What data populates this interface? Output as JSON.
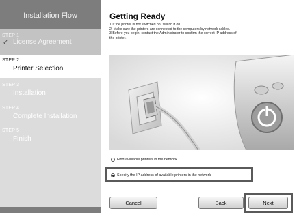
{
  "sidebar": {
    "title": "Installation Flow",
    "steps": [
      {
        "num": "STEP 1",
        "label": "License Agreement",
        "status": "done"
      },
      {
        "num": "STEP 2",
        "label": "Printer Selection",
        "status": "current"
      },
      {
        "num": "STEP 3",
        "label": "Installation",
        "status": "pending"
      },
      {
        "num": "STEP 4",
        "label": "Complete Installation",
        "status": "pending"
      },
      {
        "num": "STEP 5",
        "label": "Finish",
        "status": "pending"
      }
    ]
  },
  "main": {
    "title": "Getting Ready",
    "instructions": [
      "1.If the printer is not switched on, switch it on.",
      "2. Make sure the printers are connected to the computers by network cables.",
      "3.Before you begin, contact the Administrator to confirm the correct IP address of",
      "the printer."
    ],
    "options": [
      {
        "label": "Find available printers in the network",
        "selected": false
      },
      {
        "label": "Specify the IP address of available printers in the network",
        "selected": true
      }
    ]
  },
  "buttons": {
    "cancel": "Cancel",
    "back": "Back",
    "next": "Next"
  },
  "colors": {
    "sidebar_header": "#7d7d7d",
    "sidebar_bg": "#dcdcdc",
    "done_step_bg": "#c3c3c3",
    "current_step_bg": "#ffffff",
    "highlight_border": "#5a5a5a"
  }
}
